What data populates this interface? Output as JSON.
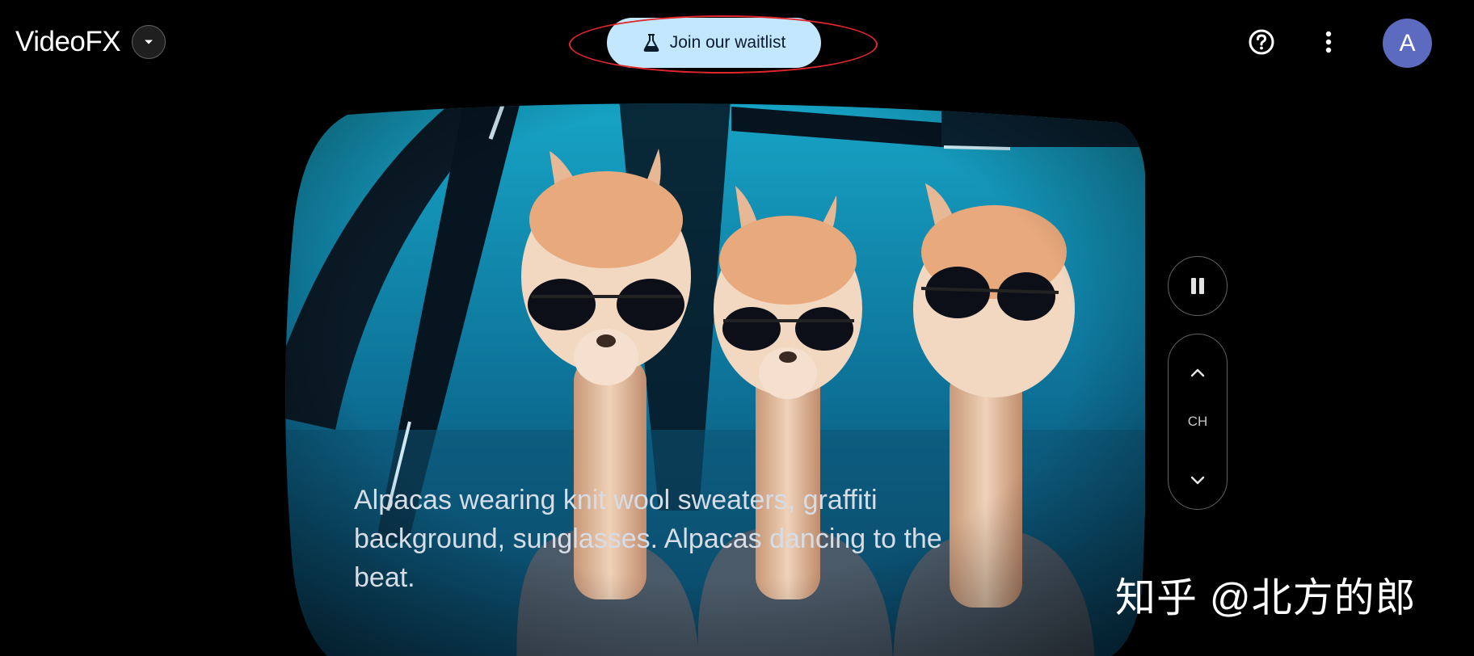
{
  "app": {
    "title": "VideoFX",
    "menu_icon": "chevron-down-icon"
  },
  "header": {
    "waitlist_label": "Join our waitlist",
    "waitlist_icon": "flask-icon",
    "help_icon": "help-icon",
    "more_icon": "more-vert-icon",
    "avatar_initial": "A",
    "avatar_color": "#5c6bc0"
  },
  "video": {
    "caption": "Alpacas wearing knit wool sweaters, graffiti background, sunglasses. Alpacas dancing to the beat."
  },
  "controls": {
    "pause_icon": "pause-icon",
    "channel_label": "CH",
    "channel_up_icon": "chevron-up-icon",
    "channel_down_icon": "chevron-down-icon"
  },
  "watermark": "知乎 @北方的郎",
  "colors": {
    "accent": "#c2e7ff",
    "highlight": "#e2262c",
    "background": "#000000"
  }
}
